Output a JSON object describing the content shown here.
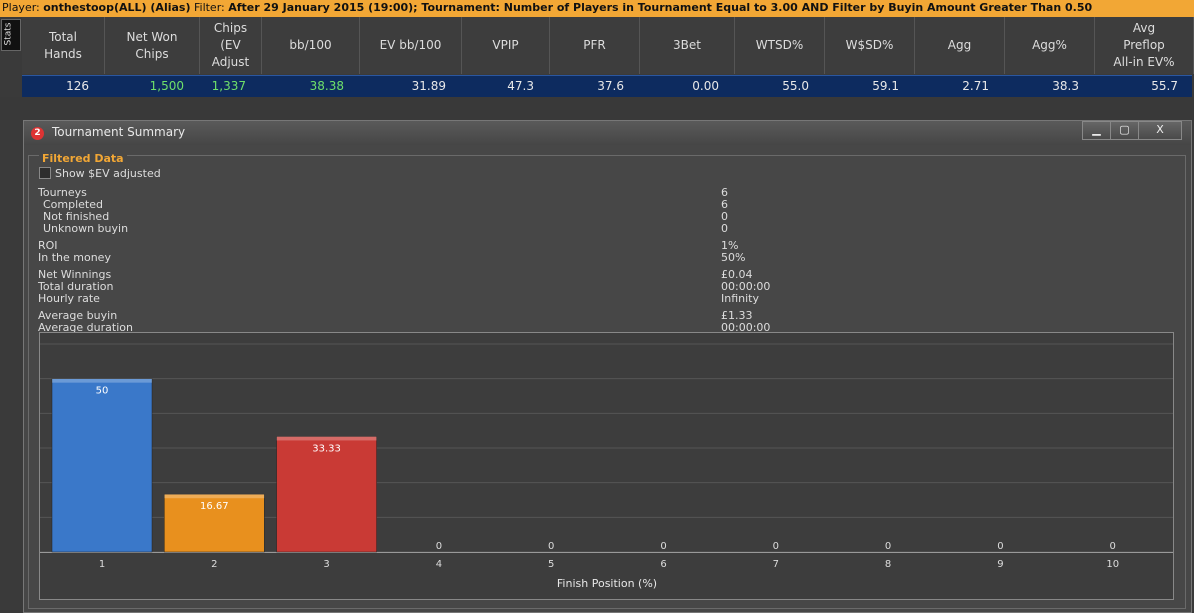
{
  "filter_bar": {
    "player_label": "Player: ",
    "player": "onthestoop(ALL) (Alias)",
    "filter_label": "  Filter: ",
    "filter": "After 29 January 2015 (19:00); Tournament: Number of Players in Tournament Equal to 3.00 AND Filter by Buyin Amount Greater Than 0.50"
  },
  "side_tab": "Stats",
  "stats": {
    "columns": [
      {
        "label": "Total\nHands",
        "value": "126",
        "color": "normal"
      },
      {
        "label": "Net Won\nChips",
        "value": "1,500",
        "color": "green"
      },
      {
        "label": "Chips\n(EV\nAdjust",
        "value": "1,337",
        "color": "green"
      },
      {
        "label": "bb/100",
        "value": "38.38",
        "color": "green"
      },
      {
        "label": "EV bb/100",
        "value": "31.89",
        "color": "normal"
      },
      {
        "label": "VPIP",
        "value": "47.3",
        "color": "normal"
      },
      {
        "label": "PFR",
        "value": "37.6",
        "color": "normal"
      },
      {
        "label": "3Bet",
        "value": "0.00",
        "color": "normal"
      },
      {
        "label": "WTSD%",
        "value": "55.0",
        "color": "normal"
      },
      {
        "label": "W$SD%",
        "value": "59.1",
        "color": "normal"
      },
      {
        "label": "Agg",
        "value": "2.71",
        "color": "normal"
      },
      {
        "label": "Agg%",
        "value": "38.3",
        "color": "normal"
      },
      {
        "label": "Avg\nPreflop\nAll-in EV%",
        "value": "55.7",
        "color": "normal"
      }
    ]
  },
  "window": {
    "logo": "2",
    "title": "Tournament Summary",
    "minimize": "▁",
    "maximize": "▢",
    "close": "X"
  },
  "filtered": {
    "section_title": "Filtered Data",
    "checkbox_label": "Show $EV adjusted",
    "rows": [
      {
        "label": "Tourneys",
        "value": "6"
      },
      {
        "label": "Completed",
        "value": "6"
      },
      {
        "label": "Not finished",
        "value": "0"
      },
      {
        "label": "Unknown buyin",
        "value": "0"
      },
      {
        "label": "ROI",
        "value": "1%"
      },
      {
        "label": "In the money",
        "value": "50%"
      },
      {
        "label": "Net Winnings",
        "value": "£0.04"
      },
      {
        "label": "Total duration",
        "value": "00:00:00"
      },
      {
        "label": "Hourly rate",
        "value": "Infinity"
      },
      {
        "label": "Average buyin",
        "value": "£1.33"
      },
      {
        "label": "Average duration",
        "value": "00:00:00"
      }
    ]
  },
  "chart_data": {
    "type": "bar",
    "xlabel": "Finish Position (%)",
    "ylabel": "",
    "categories": [
      "1",
      "2",
      "3",
      "4",
      "5",
      "6",
      "7",
      "8",
      "9",
      "10"
    ],
    "values": [
      50,
      16.67,
      33.33,
      0,
      0,
      0,
      0,
      0,
      0,
      0
    ],
    "labels": [
      "50",
      "16.67",
      "33.33",
      "0",
      "0",
      "0",
      "0",
      "0",
      "0",
      "0"
    ],
    "colors": [
      "#3a78c9",
      "#e8901e",
      "#c93a35"
    ],
    "ylim": [
      0,
      60
    ],
    "grid": true
  }
}
